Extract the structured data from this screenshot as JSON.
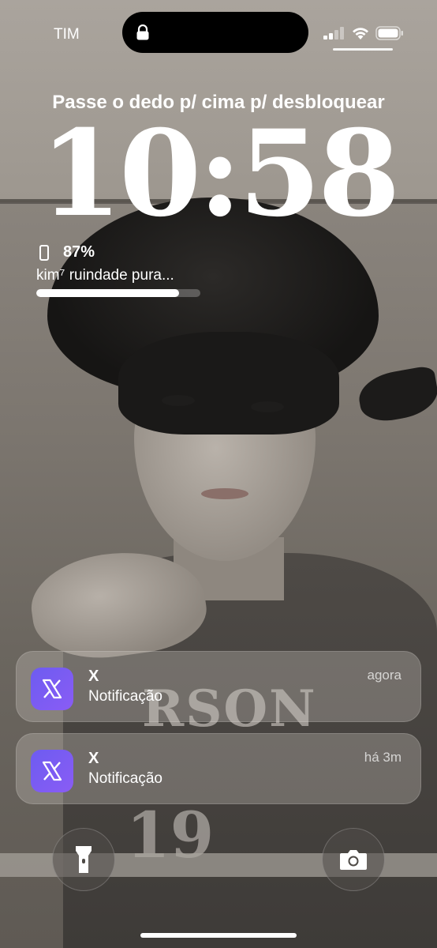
{
  "status_bar": {
    "carrier": "TIM",
    "icons": [
      "lock-icon",
      "signal-icon",
      "wifi-icon",
      "battery-icon"
    ]
  },
  "lockscreen": {
    "unlock_hint": "Passe o dedo p/ cima p/ desbloquear",
    "time": "10:58"
  },
  "widget": {
    "icon": "phone-icon",
    "battery_percent": "87%",
    "now_playing": "kim⁷ ruindade pura...",
    "progress": 0.87
  },
  "notifications": [
    {
      "app_icon": "x-logo-icon",
      "title": "X",
      "body": "Notificação",
      "time": "agora"
    },
    {
      "app_icon": "x-logo-icon",
      "title": "X",
      "body": "Notificação",
      "time": "há 3m"
    }
  ],
  "wallpaper_text": {
    "shirt": "RSON",
    "number": "19"
  },
  "buttons": {
    "left": "flashlight-icon",
    "right": "camera-icon"
  },
  "colors": {
    "app_icon_bg": "#6d5cf0",
    "text": "#ffffff"
  }
}
